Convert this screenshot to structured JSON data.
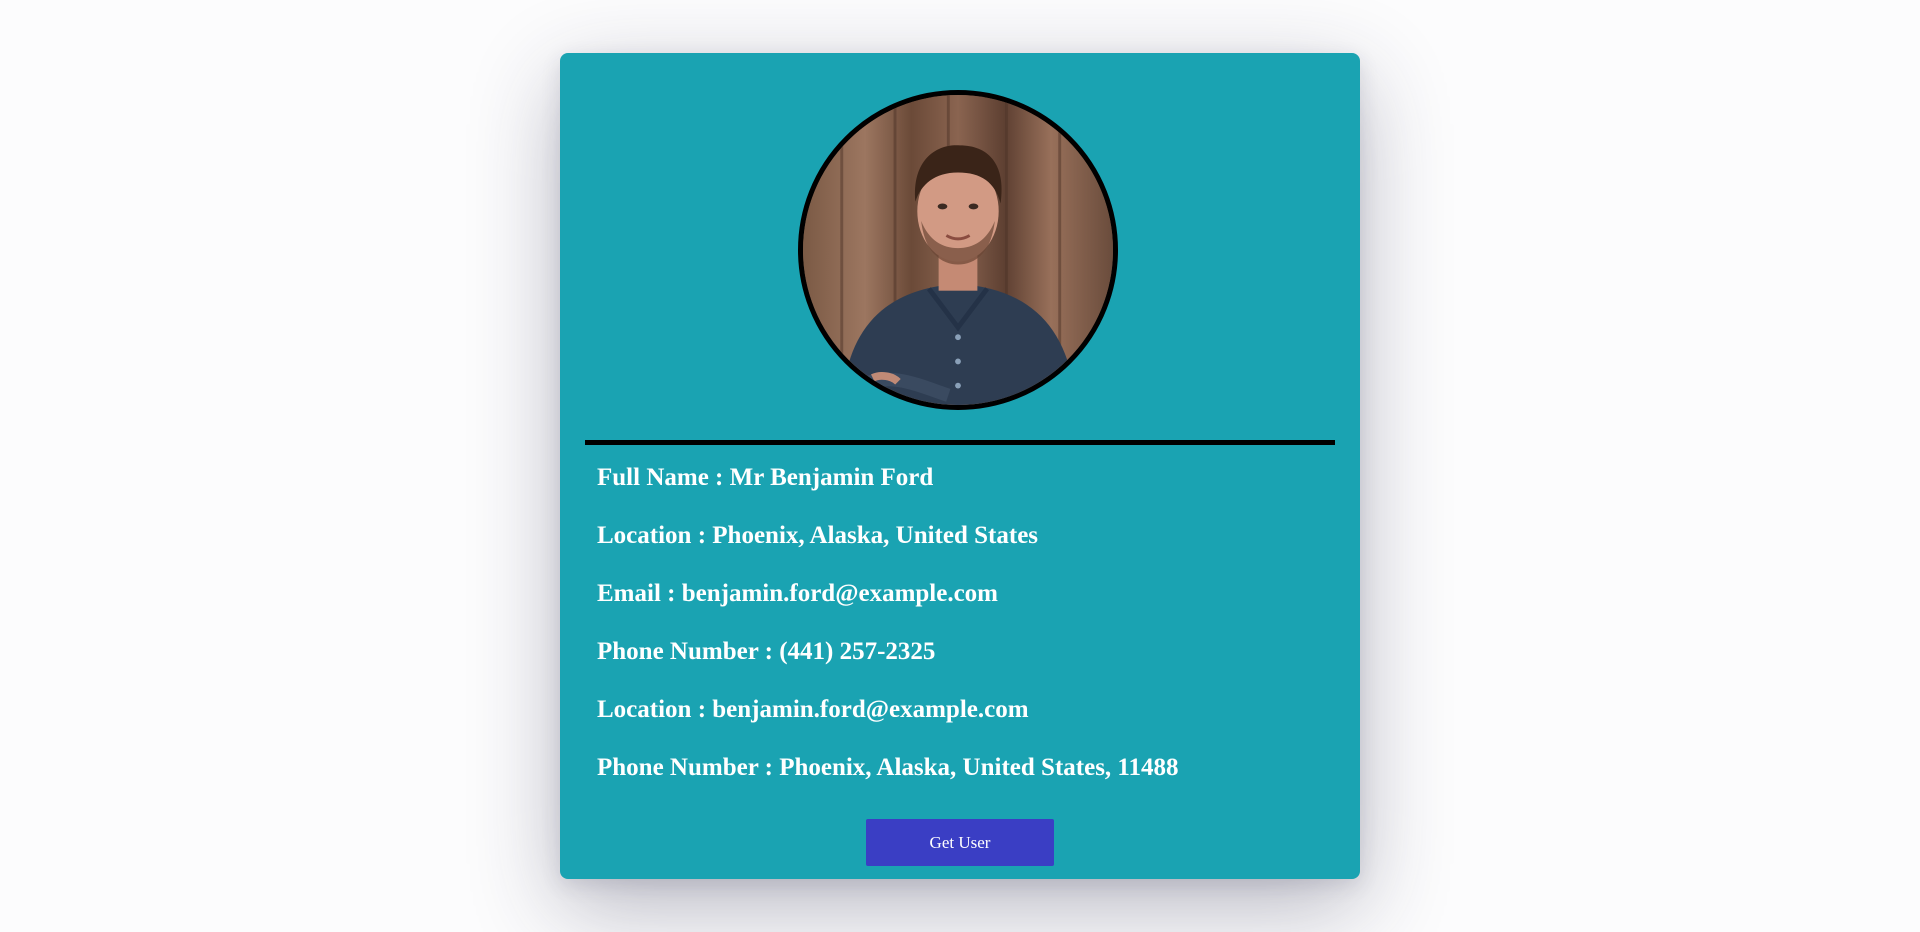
{
  "profile": {
    "fields": [
      {
        "label": "Full Name",
        "value": "Mr Benjamin Ford"
      },
      {
        "label": "Location",
        "value": "Phoenix, Alaska, United States"
      },
      {
        "label": "Email",
        "value": "benjamin.ford@example.com"
      },
      {
        "label": "Phone Number",
        "value": "(441) 257-2325"
      },
      {
        "label": "Location",
        "value": "benjamin.ford@example.com"
      },
      {
        "label": "Phone Number",
        "value": "Phoenix, Alaska, United States, 11488"
      }
    ],
    "separator": " : "
  },
  "actions": {
    "get_user_label": "Get User"
  },
  "colors": {
    "card": "#1aa3b2",
    "button": "#3a3ec4",
    "text": "#ffffff",
    "divider": "#000000"
  }
}
